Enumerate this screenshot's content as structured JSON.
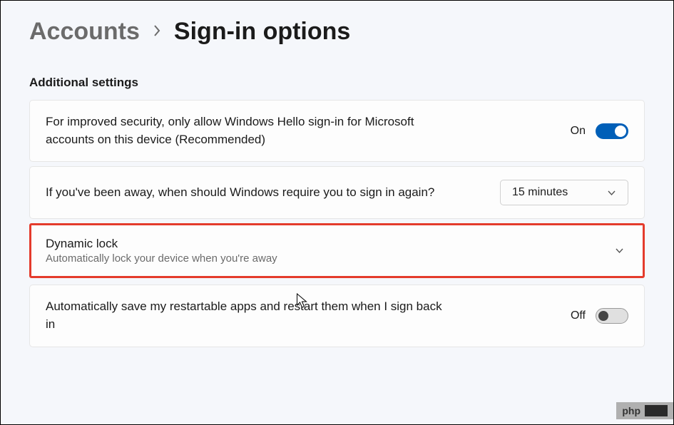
{
  "breadcrumb": {
    "parent": "Accounts",
    "current": "Sign-in options"
  },
  "section_heading": "Additional settings",
  "rows": {
    "hello": {
      "text": "For improved security, only allow Windows Hello sign-in for Microsoft accounts on this device (Recommended)",
      "state": "On"
    },
    "away": {
      "text": "If you've been away, when should Windows require you to sign in again?",
      "dropdown_value": "15 minutes"
    },
    "dynamic_lock": {
      "title": "Dynamic lock",
      "sub": "Automatically lock your device when you're away"
    },
    "restart_apps": {
      "text": "Automatically save my restartable apps and restart them when I sign back in",
      "state": "Off"
    }
  },
  "watermark": "php"
}
